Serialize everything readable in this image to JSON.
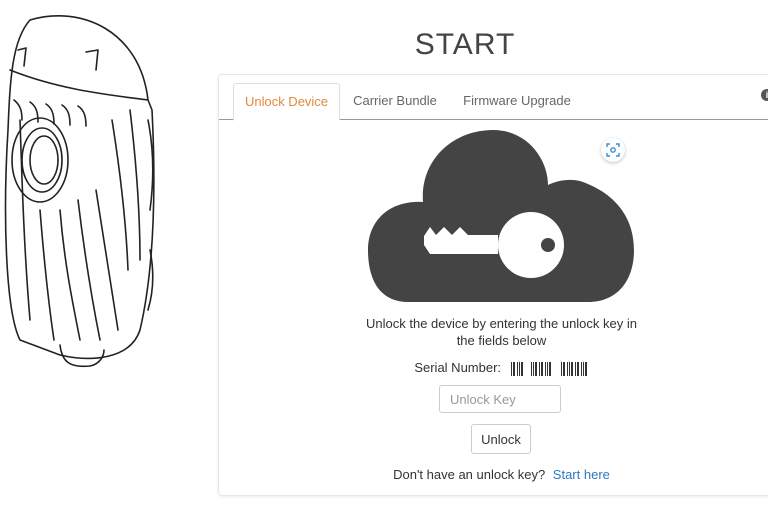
{
  "page": {
    "title": "START"
  },
  "tabs": [
    {
      "label": "Unlock Device",
      "active": true
    },
    {
      "label": "Carrier Bundle",
      "active": false
    },
    {
      "label": "Firmware Upgrade",
      "active": false
    }
  ],
  "unlock": {
    "instructions": "Unlock the device by entering the unlock key in the fields below",
    "serial_label": "Serial Number:",
    "key_placeholder": "Unlock Key",
    "unlock_label": "Unlock",
    "no_key_text": "Don't have an unlock key?",
    "start_link": "Start here"
  },
  "icons": {
    "info": "info-icon",
    "scan": "scan-icon",
    "cloud": "cloud-key-icon",
    "device": "device-illustration"
  },
  "colors": {
    "active_tab": "#e08a3c",
    "link": "#2a7bbf",
    "cloud": "#444444"
  }
}
